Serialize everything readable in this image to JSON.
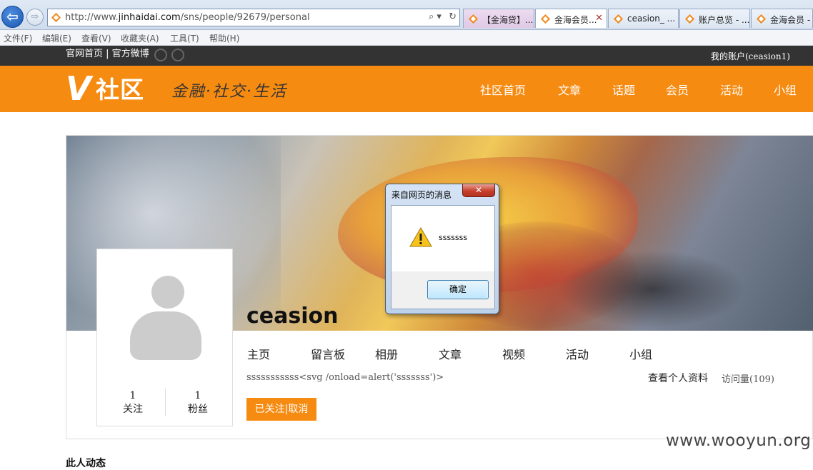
{
  "browser": {
    "url_prefix": "http://www.",
    "url_domain": "jinhaidai.com",
    "url_path": "/sns/people/92679/personal",
    "url_tools": [
      "⌕ ▾",
      "↻"
    ],
    "tabs": [
      {
        "label": "【金海贷】...",
        "style": "pinkish"
      },
      {
        "label": "金海会员...",
        "style": "active"
      },
      {
        "label": "ceasion_ ...",
        "style": "normal"
      },
      {
        "label": "账户总览 - ...",
        "style": "normal"
      },
      {
        "label": "金海会员 -",
        "style": "normal"
      }
    ],
    "tab_close": "✕",
    "menu": [
      "文件(F)",
      "编辑(E)",
      "查看(V)",
      "收藏夹(A)",
      "工具(T)",
      "帮助(H)"
    ],
    "back_arrow": "⇦",
    "forward_arrow": "⇨"
  },
  "site": {
    "topbar_links": "官网首页 | 官方微博",
    "account": "我的账户(ceasion1)",
    "logo_v": "V",
    "logo_text": "社区",
    "slogan": "金融·社交·生活",
    "nav": [
      "社区首页",
      "文章",
      "话题",
      "会员",
      "活动",
      "小组"
    ]
  },
  "profile": {
    "follow_count": "1",
    "follow_label": "关注",
    "fans_count": "1",
    "fans_label": "粉丝",
    "username": "ceasion",
    "tabs": [
      "主页",
      "留言板",
      "相册",
      "文章",
      "视频",
      "活动",
      "小组"
    ],
    "bio": "sssssssssss<svg /onload=alert('sssssss')>",
    "view_profile": "查看个人资料",
    "visits": "访问量(109)",
    "follow_btn_left": "已关注",
    "follow_btn_sep": "|",
    "follow_btn_right": "取消",
    "below_title": "此人动态"
  },
  "dialog": {
    "title": "来自网页的消息",
    "close": "✕",
    "message": "sssssss",
    "ok": "确定"
  },
  "watermark": "www.wooyun.org",
  "colors": {
    "brand_orange": "#f68b12",
    "topbar": "#333333"
  }
}
